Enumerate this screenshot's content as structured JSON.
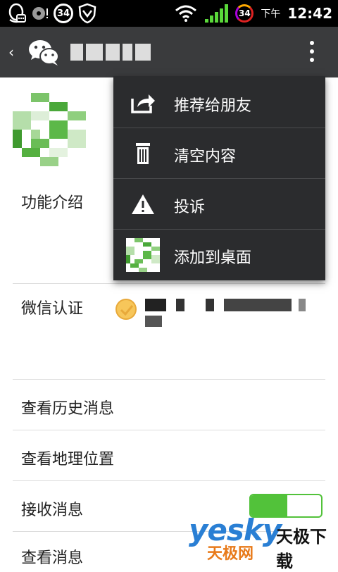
{
  "status_bar": {
    "badge_left": "34",
    "badge_right": "34",
    "ampm": "下午",
    "time": "12:42"
  },
  "menu": {
    "items": [
      {
        "label": "推荐给朋友",
        "icon": "share-icon"
      },
      {
        "label": "清空内容",
        "icon": "trash-icon"
      },
      {
        "label": "投诉",
        "icon": "warning-icon"
      },
      {
        "label": "添加到桌面",
        "icon": "avatar-thumbnail"
      }
    ]
  },
  "rows": {
    "intro_label": "功能介绍",
    "verify_label": "微信认证",
    "history_label": "查看历史消息",
    "location_label": "查看地理位置",
    "receive_label": "接收消息",
    "view_label": "查看消息"
  },
  "toggle": {
    "receive_messages_on": true
  },
  "colors": {
    "actionbar": "#3a3b3d",
    "menu_bg": "#2b2c2e",
    "toggle_green": "#52c23a",
    "verify_badge": "#f7c65a"
  },
  "watermark": {
    "brand": "yesky",
    "brand_cn": "天极下载",
    "sub": "天极网"
  }
}
